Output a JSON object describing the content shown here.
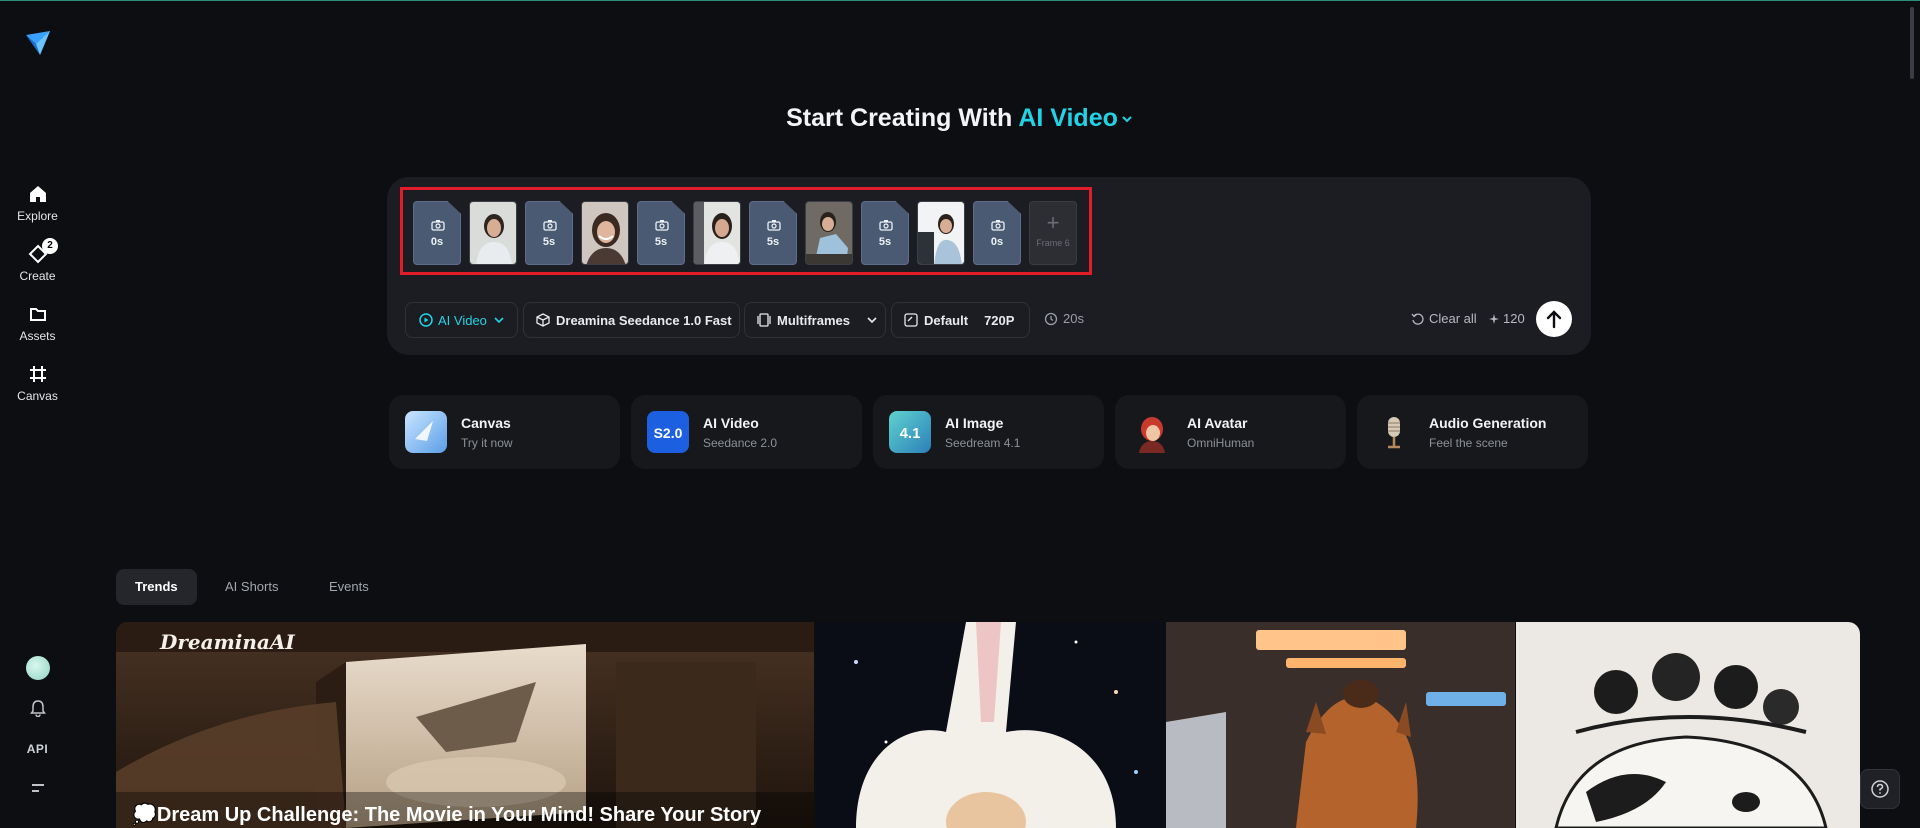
{
  "sidebar": {
    "logo": "dreamina-logo",
    "items": [
      {
        "label": "Explore",
        "icon": "home-icon"
      },
      {
        "label": "Create",
        "icon": "create-icon",
        "badge": "2"
      },
      {
        "label": "Assets",
        "icon": "folder-icon"
      },
      {
        "label": "Canvas",
        "icon": "canvas-icon"
      }
    ],
    "bottom": {
      "api_label": "API"
    }
  },
  "heading": {
    "prefix": "Start Creating With",
    "mode": "AI Video"
  },
  "frames": [
    {
      "type": "slot",
      "duration": "0s"
    },
    {
      "type": "image"
    },
    {
      "type": "slot",
      "duration": "5s"
    },
    {
      "type": "image"
    },
    {
      "type": "slot",
      "duration": "5s"
    },
    {
      "type": "image"
    },
    {
      "type": "slot",
      "duration": "5s"
    },
    {
      "type": "image"
    },
    {
      "type": "slot",
      "duration": "5s"
    },
    {
      "type": "image"
    },
    {
      "type": "slot",
      "duration": "0s"
    },
    {
      "type": "add",
      "label": "Frame 6"
    }
  ],
  "toolbar": {
    "mode_label": "AI Video",
    "model_label": "Dreamina Seedance 1.0 Fast",
    "frames_label": "Multiframes",
    "aspect_label": "Default",
    "resolution_label": "720P",
    "duration_label": "20s",
    "clear_label": "Clear all",
    "credits": "120"
  },
  "cards": [
    {
      "title": "Canvas",
      "subtitle": "Try it now"
    },
    {
      "title": "AI Video",
      "subtitle": "Seedance 2.0",
      "thumb_text": "S2.0"
    },
    {
      "title": "AI Image",
      "subtitle": "Seedream 4.1",
      "thumb_text": "4.1"
    },
    {
      "title": "AI Avatar",
      "subtitle": "OmniHuman"
    },
    {
      "title": "Audio Generation",
      "subtitle": "Feel the scene"
    }
  ],
  "tabs": [
    "Trends",
    "AI Shorts",
    "Events"
  ],
  "gallery": {
    "featured_brand": "DreaminaAI",
    "featured_title": "💭Dream Up Challenge: The Movie in Your Mind! Share Your Story"
  },
  "colors": {
    "accent": "#22d3e6",
    "highlight_box": "#e11d2a",
    "background": "#0d0e11",
    "panel": "#1c1d22"
  }
}
